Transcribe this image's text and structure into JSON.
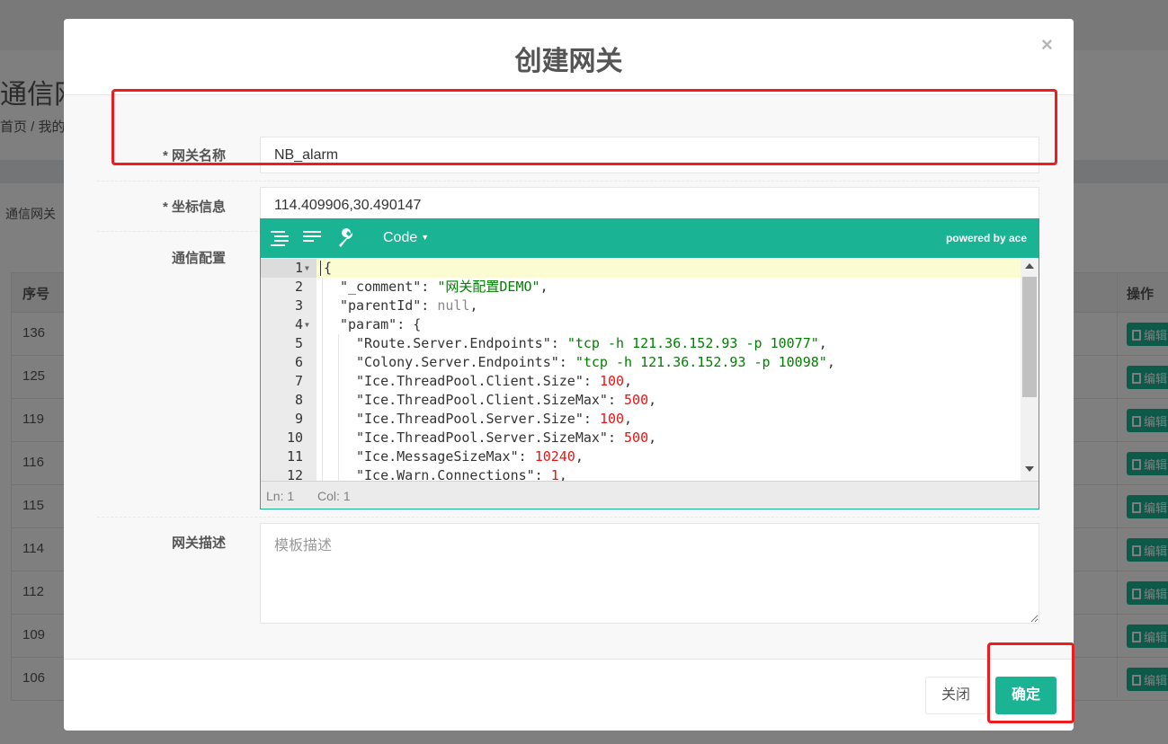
{
  "background": {
    "page_title": "通信网",
    "breadcrumb": "首页  /   我的",
    "subtitle": "通信网关",
    "table": {
      "col_no": "序号",
      "col_op": "操作",
      "rows": [
        "136",
        "125",
        "119",
        "116",
        "115",
        "114",
        "112",
        "109",
        "106"
      ],
      "edit_label": "编辑"
    }
  },
  "modal": {
    "title": "创建网关",
    "close_glyph": "×",
    "fields": {
      "name": {
        "label": "* 网关名称",
        "value": "NB_alarm"
      },
      "coords": {
        "label": "* 坐标信息",
        "value": "114.409906,30.490147"
      },
      "config": {
        "label": "通信配置"
      },
      "desc": {
        "label": "网关描述",
        "placeholder": "模板描述",
        "value": ""
      }
    },
    "editor": {
      "mode_label": "Code",
      "powered_by": "powered by ace",
      "toolbar_icons": [
        "format-icon",
        "compact-icon",
        "repair-icon"
      ],
      "status_ln": "Ln: 1",
      "status_col": "Col: 1",
      "lines": [
        {
          "no": "1",
          "fold": true,
          "indent": 0,
          "tokens": [
            [
              "k",
              "{"
            ]
          ]
        },
        {
          "no": "2",
          "fold": false,
          "indent": 1,
          "tokens": [
            [
              "k",
              "\"_comment\": "
            ],
            [
              "s",
              "\"网关配置DEMO\""
            ],
            [
              "k",
              ","
            ]
          ]
        },
        {
          "no": "3",
          "fold": false,
          "indent": 1,
          "tokens": [
            [
              "k",
              "\"parentId\": "
            ],
            [
              "nl",
              "null"
            ],
            [
              "k",
              ","
            ]
          ]
        },
        {
          "no": "4",
          "fold": true,
          "indent": 1,
          "tokens": [
            [
              "k",
              "\"param\": {"
            ]
          ]
        },
        {
          "no": "5",
          "fold": false,
          "indent": 2,
          "tokens": [
            [
              "k",
              "\"Route.Server.Endpoints\": "
            ],
            [
              "s",
              "\"tcp -h 121.36.152.93 -p 10077\""
            ],
            [
              "k",
              ","
            ]
          ]
        },
        {
          "no": "6",
          "fold": false,
          "indent": 2,
          "tokens": [
            [
              "k",
              "\"Colony.Server.Endpoints\": "
            ],
            [
              "s",
              "\"tcp -h 121.36.152.93 -p 10098\""
            ],
            [
              "k",
              ","
            ]
          ]
        },
        {
          "no": "7",
          "fold": false,
          "indent": 2,
          "tokens": [
            [
              "k",
              "\"Ice.ThreadPool.Client.Size\": "
            ],
            [
              "n",
              "100"
            ],
            [
              "k",
              ","
            ]
          ]
        },
        {
          "no": "8",
          "fold": false,
          "indent": 2,
          "tokens": [
            [
              "k",
              "\"Ice.ThreadPool.Client.SizeMax\": "
            ],
            [
              "n",
              "500"
            ],
            [
              "k",
              ","
            ]
          ]
        },
        {
          "no": "9",
          "fold": false,
          "indent": 2,
          "tokens": [
            [
              "k",
              "\"Ice.ThreadPool.Server.Size\": "
            ],
            [
              "n",
              "100"
            ],
            [
              "k",
              ","
            ]
          ]
        },
        {
          "no": "10",
          "fold": false,
          "indent": 2,
          "tokens": [
            [
              "k",
              "\"Ice.ThreadPool.Server.SizeMax\": "
            ],
            [
              "n",
              "500"
            ],
            [
              "k",
              ","
            ]
          ]
        },
        {
          "no": "11",
          "fold": false,
          "indent": 2,
          "tokens": [
            [
              "k",
              "\"Ice.MessageSizeMax\": "
            ],
            [
              "n",
              "10240"
            ],
            [
              "k",
              ","
            ]
          ]
        },
        {
          "no": "12",
          "fold": false,
          "indent": 2,
          "tokens": [
            [
              "k",
              "\"Ice.Warn.Connections\": "
            ],
            [
              "n",
              "1"
            ],
            [
              "k",
              ","
            ]
          ]
        }
      ]
    },
    "footer": {
      "close_label": "关闭",
      "confirm_label": "确定"
    }
  },
  "colors": {
    "accent": "#1ab394",
    "highlight": "#ee1c1c"
  }
}
